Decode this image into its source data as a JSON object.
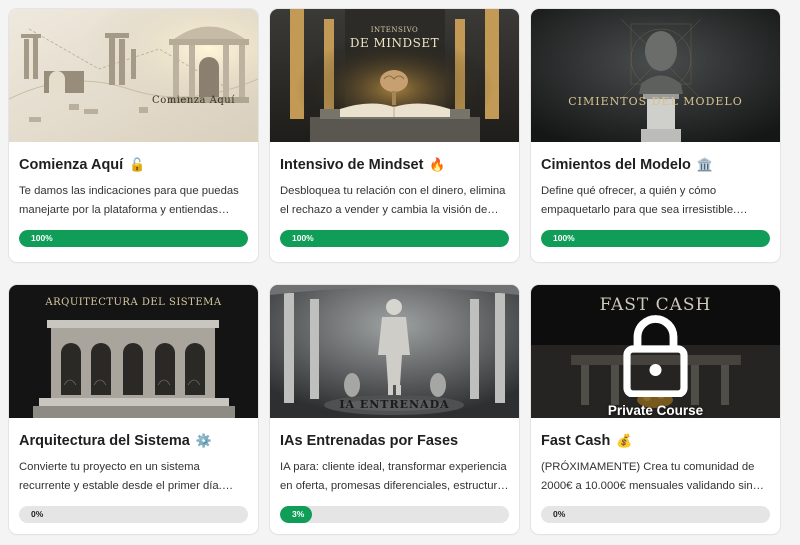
{
  "courses": [
    {
      "title": "Comienza Aquí",
      "emoji": "🔓",
      "image_caption": "Comienza Aquí",
      "description": "Te damos las indicaciones para que puedas manejarte por la plataforma y entiendas…",
      "progress_label": "100%",
      "progress": 100
    },
    {
      "title": "Intensivo de Mindset",
      "emoji": "🔥",
      "image_caption_top": "INTENSIVO",
      "image_caption": "DE MINDSET",
      "description": "Desbloquea tu relación con el dinero, elimina el rechazo a vender y cambia la visión de…",
      "progress_label": "100%",
      "progress": 100
    },
    {
      "title": "Cimientos del Modelo",
      "emoji": "🏛️",
      "image_caption": "CIMIENTOS DEL MODELO",
      "description": "Define qué ofrecer, a quién y cómo empaquetarlo para que sea irresistible.…",
      "progress_label": "100%",
      "progress": 100
    },
    {
      "title": "Arquitectura del Sistema",
      "emoji": "⚙️",
      "image_caption": "ARQUITECTURA DEL SISTEMA",
      "description": "Convierte tu proyecto en un sistema recurrente y estable desde el primer día.…",
      "progress_label": "0%",
      "progress": 0
    },
    {
      "title": "IAs Entrenadas por Fases",
      "emoji": "",
      "image_caption": "IA ENTRENADA",
      "description": "IA para: cliente ideal, transformar experiencia en oferta, promesas diferenciales, estructur…",
      "progress_label": "3%",
      "progress": 3
    },
    {
      "title": "Fast Cash",
      "emoji": "💰",
      "image_caption": "FAST CASH",
      "lock_label": "Private Course",
      "description": "(PRÓXIMAMENTE) Crea tu comunidad de 2000€ a 10.000€ mensuales validando sin…",
      "progress_label": "0%",
      "progress": 0
    }
  ],
  "colors": {
    "progress_fill": "#0f9d58",
    "progress_track": "#e5e5e5",
    "background": "#f4f4f5"
  }
}
